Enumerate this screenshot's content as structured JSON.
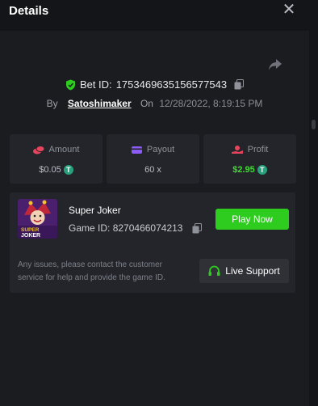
{
  "header": {
    "title": "Details",
    "close_icon": "✕"
  },
  "bet": {
    "id_label": "Bet ID:",
    "id_value": "1753469635156577543",
    "by_label": "By",
    "username": "Satoshimaker",
    "on_label": "On",
    "date": "12/28/2022, 8:19:15 PM"
  },
  "stats": {
    "amount": {
      "label": "Amount",
      "value": "$0.05",
      "icon": "coins-icon"
    },
    "payout": {
      "label": "Payout",
      "value": "60 x",
      "icon": "wallet-icon"
    },
    "profit": {
      "label": "Profit",
      "value": "$2.95",
      "icon": "hand-coin-icon"
    }
  },
  "game": {
    "name": "Super Joker",
    "id_label": "Game ID:",
    "id_value": "8270466074213",
    "play_label": "Play Now",
    "thumbnail_text": [
      "SUPER",
      "JOKER"
    ]
  },
  "support": {
    "notice": "Any issues, please contact the customer service for help and provide the game ID.",
    "button_label": "Live Support"
  },
  "colors": {
    "background": "#1b1c20",
    "panel": "#23252b",
    "accent_green": "#2ecc1f",
    "profit_green": "#3ddc2f",
    "tether": "#26a17b"
  }
}
